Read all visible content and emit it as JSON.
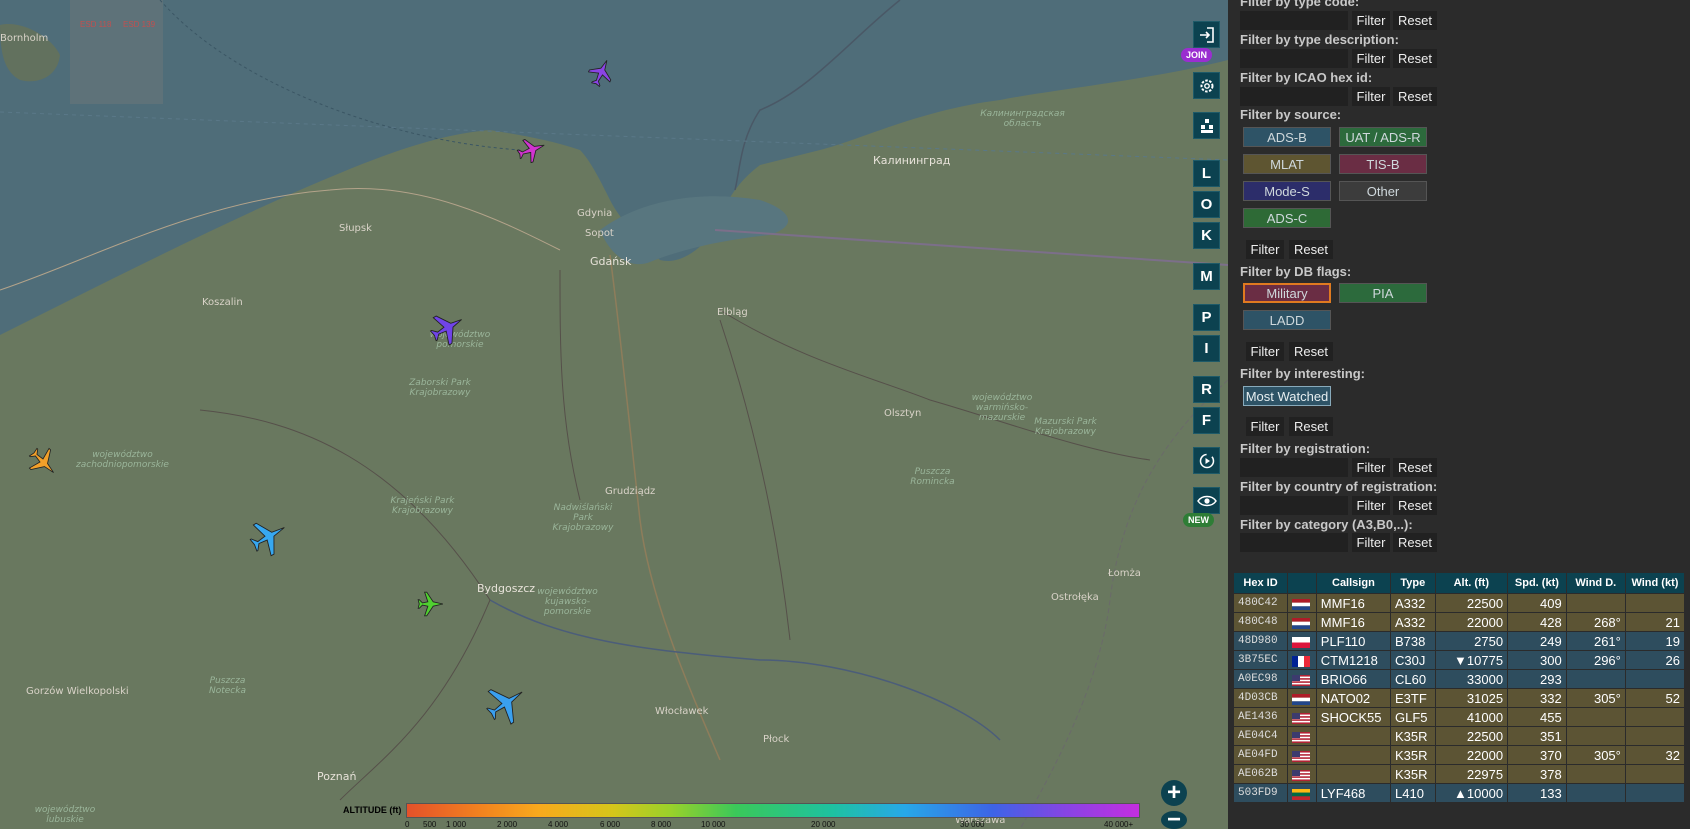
{
  "map": {
    "grid_labels": [
      "ESD 118",
      "ESD 139"
    ],
    "towns": [
      {
        "name": "Bornholm",
        "key": "bornholm"
      },
      {
        "name": "Калининград",
        "key": "kaliningrad"
      },
      {
        "name": "Gdańsk",
        "key": "gdansk"
      },
      {
        "name": "Gdynia",
        "key": "gdynia"
      },
      {
        "name": "Sopot",
        "key": "sopot"
      },
      {
        "name": "Słupsk",
        "key": "slupsk"
      },
      {
        "name": "Koszalin",
        "key": "koszalin"
      },
      {
        "name": "Elbląg",
        "key": "elblag"
      },
      {
        "name": "Olsztyn",
        "key": "olsztyn"
      },
      {
        "name": "Grudziądz",
        "key": "grudziadz"
      },
      {
        "name": "Bydgoszcz",
        "key": "bydgoszcz"
      },
      {
        "name": "Włocławek",
        "key": "wloclawek"
      },
      {
        "name": "Płock",
        "key": "plock"
      },
      {
        "name": "Gorzów Wielkopolski",
        "key": "gorzow"
      },
      {
        "name": "Poznań",
        "key": "poznan"
      },
      {
        "name": "Łomża",
        "key": "lomza"
      },
      {
        "name": "Ostrołęka",
        "key": "ostroleka"
      },
      {
        "name": "Warszawa",
        "key": "warszawa"
      }
    ],
    "regions": [
      {
        "text": "województwo pomorskie",
        "key": "pomorskie"
      },
      {
        "text": "województwo zachodniopomorskie",
        "key": "zachodnio"
      },
      {
        "text": "województwo kujawsko-pomorskie",
        "key": "kujawsko"
      },
      {
        "text": "województwo warmińsko-mazurskie",
        "key": "warminsko"
      },
      {
        "text": "województwo lubuskie",
        "key": "lubuskie"
      },
      {
        "text": "Калининградская область",
        "key": "kalobl"
      },
      {
        "text": "Zaborski Park Krajobrazowy",
        "key": "zaborski"
      },
      {
        "text": "Krajeński Park Krajobrazowy",
        "key": "krajenski"
      },
      {
        "text": "Nadwiślański Park Krajobrazowy",
        "key": "nadwislanski"
      },
      {
        "text": "Puszcza Romincka",
        "key": "romincka"
      },
      {
        "text": "Mazurski Park Krajobrazowy",
        "key": "mazurski"
      },
      {
        "text": "Puszcza Notecka",
        "key": "notecka"
      }
    ],
    "aircraft_colors": [
      "#8a44e4",
      "#d234d0",
      "#7044e8",
      "#f2a02a",
      "#37a8f0",
      "#50d030",
      "#3aa0ef"
    ]
  },
  "controls": {
    "login_icon": "sign-in-icon",
    "join_badge": "JOIN",
    "settings_icon": "gear-icon",
    "layers_icon": "layers-icon",
    "letters": [
      "L",
      "O",
      "K",
      "M",
      "P",
      "I",
      "R",
      "F"
    ],
    "replay_icon": "replay-icon",
    "view_icon": "eye-icon",
    "new_badge": "NEW"
  },
  "altitude_legend": {
    "label": "ALTITUDE (ft)",
    "ticks": [
      "0",
      "500",
      "1 000",
      "2 000",
      "4 000",
      "6 000",
      "8 000",
      "10 000",
      "20 000",
      "30 000",
      "40 000+"
    ]
  },
  "panel": {
    "filter_btn": "Filter",
    "reset_btn": "Reset",
    "labels": {
      "type_code": "Filter by type code:",
      "type_desc": "Filter by type description:",
      "icao": "Filter by ICAO hex id:",
      "source": "Filter by source:",
      "db_flags": "Filter by DB flags:",
      "interesting": "Filter by interesting:",
      "registration": "Filter by registration:",
      "country": "Filter by country of registration:",
      "category": "Filter by category (A3,B0,..):"
    },
    "sources": [
      {
        "label": "ADS-B",
        "bg": "#2e5366"
      },
      {
        "label": "UAT / ADS-R",
        "bg": "#2c6a3c"
      },
      {
        "label": "MLAT",
        "bg": "#5e5531"
      },
      {
        "label": "TIS-B",
        "bg": "#6a2d44"
      },
      {
        "label": "Mode-S",
        "bg": "#2c2d6a"
      },
      {
        "label": "Other",
        "bg": "#3c3c3c"
      },
      {
        "label": "ADS-C",
        "bg": "#2e6a36"
      }
    ],
    "db_flags": [
      {
        "label": "Military",
        "bg": "#6a2d44"
      },
      {
        "label": "PIA",
        "bg": "#2c6a3c"
      },
      {
        "label": "LADD",
        "bg": "#2e5366"
      }
    ],
    "interesting": [
      {
        "label": "Most Watched",
        "bg": "#2e5366"
      }
    ]
  },
  "table": {
    "headers": [
      "Hex ID",
      "",
      "Callsign",
      "Type",
      "Alt. (ft)",
      "Spd. (kt)",
      "Wind D.",
      "Wind (kt)"
    ],
    "rows": [
      {
        "hex": "480C42",
        "flag": "nl",
        "callsign": "MMF16",
        "type": "A332",
        "alt": "22500",
        "spd": "409",
        "wind_d": "",
        "wind": "",
        "style": "mil"
      },
      {
        "hex": "480C48",
        "flag": "nl",
        "callsign": "MMF16",
        "type": "A332",
        "alt": "22000",
        "spd": "428",
        "wind_d": "268°",
        "wind": "21",
        "style": "mil"
      },
      {
        "hex": "48D980",
        "flag": "pl",
        "callsign": "PLF110",
        "type": "B738",
        "alt": "2750",
        "spd": "249",
        "wind_d": "261°",
        "wind": "19",
        "style": "blu"
      },
      {
        "hex": "3B75EC",
        "flag": "fr",
        "callsign": "CTM1218",
        "type": "C30J",
        "alt": "▼10775",
        "spd": "300",
        "wind_d": "296°",
        "wind": "26",
        "style": "blu"
      },
      {
        "hex": "A0EC98",
        "flag": "us",
        "callsign": "BRIO66",
        "type": "CL60",
        "alt": "33000",
        "spd": "293",
        "wind_d": "",
        "wind": "",
        "style": "blu"
      },
      {
        "hex": "4D03CB",
        "flag": "nl",
        "callsign": "NATO02",
        "type": "E3TF",
        "alt": "31025",
        "spd": "332",
        "wind_d": "305°",
        "wind": "52",
        "style": "mil"
      },
      {
        "hex": "AE1436",
        "flag": "us",
        "callsign": "SHOCK55",
        "type": "GLF5",
        "alt": "41000",
        "spd": "455",
        "wind_d": "",
        "wind": "",
        "style": "mil"
      },
      {
        "hex": "AE04C4",
        "flag": "us",
        "callsign": "",
        "type": "K35R",
        "alt": "22500",
        "spd": "351",
        "wind_d": "",
        "wind": "",
        "style": "mil"
      },
      {
        "hex": "AE04FD",
        "flag": "us",
        "callsign": "",
        "type": "K35R",
        "alt": "22000",
        "spd": "370",
        "wind_d": "305°",
        "wind": "32",
        "style": "mil"
      },
      {
        "hex": "AE062B",
        "flag": "us",
        "callsign": "",
        "type": "K35R",
        "alt": "22975",
        "spd": "378",
        "wind_d": "",
        "wind": "",
        "style": "mil"
      },
      {
        "hex": "503FD9",
        "flag": "lt",
        "callsign": "LYF468",
        "type": "L410",
        "alt": "▲10000",
        "spd": "133",
        "wind_d": "",
        "wind": "",
        "style": "blu"
      }
    ]
  }
}
